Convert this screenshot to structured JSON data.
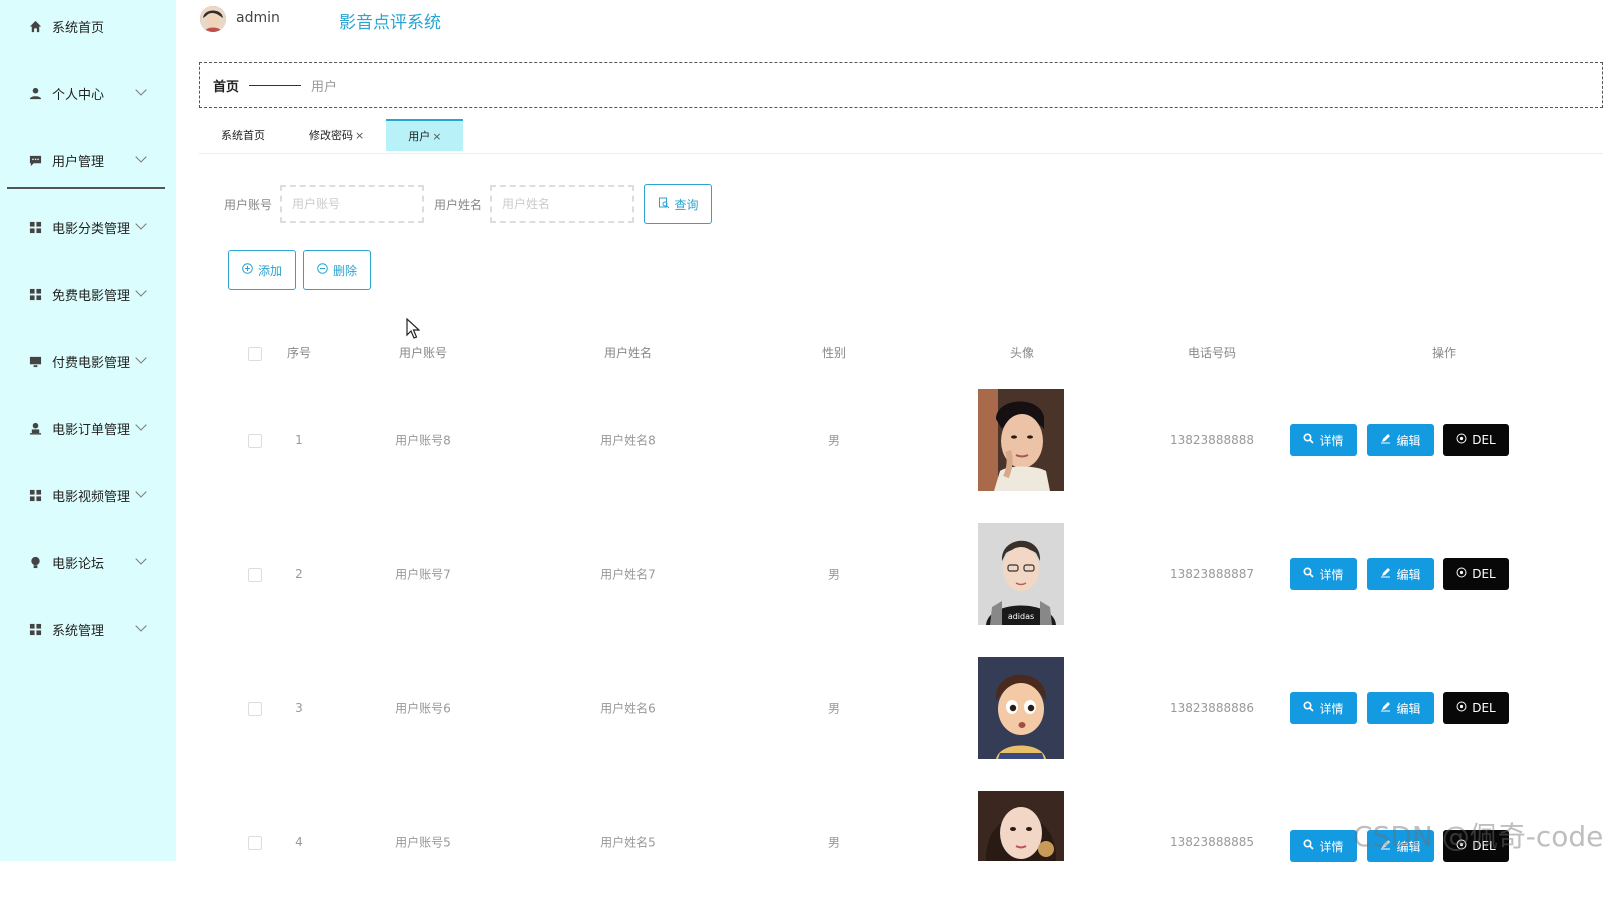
{
  "app": {
    "username": "admin",
    "title": "影音点评系统"
  },
  "sidebar": {
    "items": [
      {
        "label": "系统首页",
        "icon": "home-icon",
        "has_chevron": false
      },
      {
        "label": "个人中心",
        "icon": "user-icon",
        "has_chevron": true
      },
      {
        "label": "用户管理",
        "icon": "chat-icon",
        "has_chevron": true
      },
      {
        "label": "电影分类管理",
        "icon": "grid-icon",
        "has_chevron": true
      },
      {
        "label": "免费电影管理",
        "icon": "grid-icon",
        "has_chevron": true
      },
      {
        "label": "付费电影管理",
        "icon": "monitor-icon",
        "has_chevron": true
      },
      {
        "label": "电影订单管理",
        "icon": "person-icon",
        "has_chevron": true
      },
      {
        "label": "电影视频管理",
        "icon": "grid-icon",
        "has_chevron": true
      },
      {
        "label": "电影论坛",
        "icon": "bulb-icon",
        "has_chevron": true
      },
      {
        "label": "系统管理",
        "icon": "grid-icon",
        "has_chevron": true
      }
    ]
  },
  "breadcrumb": {
    "home": "首页",
    "current": "用户"
  },
  "tabs": [
    {
      "label": "系统首页",
      "closable": false,
      "active": false
    },
    {
      "label": "修改密码",
      "closable": true,
      "active": false
    },
    {
      "label": "用户",
      "closable": true,
      "active": true
    }
  ],
  "tab_close": "×",
  "search": {
    "account_label": "用户账号",
    "account_placeholder": "用户账号",
    "name_label": "用户姓名",
    "name_placeholder": "用户姓名",
    "query_button": "查询"
  },
  "toolbar": {
    "add_label": "添加",
    "delete_label": "删除"
  },
  "table": {
    "headers": {
      "index": "序号",
      "account": "用户账号",
      "name": "用户姓名",
      "gender": "性别",
      "avatar": "头像",
      "phone": "电话号码",
      "actions": "操作"
    },
    "rows": [
      {
        "index": "1",
        "account": "用户账号8",
        "name": "用户姓名8",
        "gender": "男",
        "phone": "13823888888",
        "avatar": "portrait-photo"
      },
      {
        "index": "2",
        "account": "用户账号7",
        "name": "用户姓名7",
        "gender": "男",
        "phone": "13823888887",
        "avatar": "cartoon-man-photo"
      },
      {
        "index": "3",
        "account": "用户账号6",
        "name": "用户姓名6",
        "gender": "男",
        "phone": "13823888886",
        "avatar": "cartoon-boy-photo"
      },
      {
        "index": "4",
        "account": "用户账号5",
        "name": "用户姓名5",
        "gender": "男",
        "phone": "13823888885",
        "avatar": "girl-photo"
      }
    ],
    "detail_label": "详情",
    "edit_label": "编辑",
    "del_label": "DEL"
  },
  "watermark": "CSDN @佩奇-code",
  "colors": {
    "sidebar_bg": "#dcfdfd",
    "accent": "#2aa4d0",
    "button_blue": "#149ae0",
    "button_dark": "#080808",
    "active_tab": "#b8f2f8"
  }
}
